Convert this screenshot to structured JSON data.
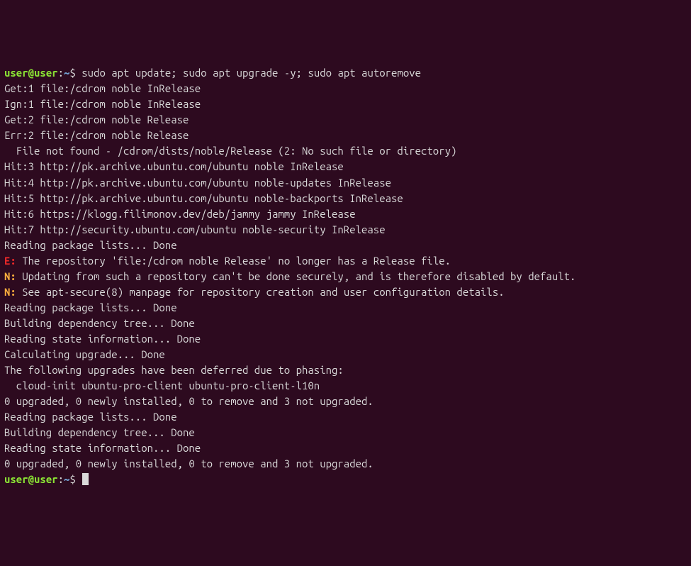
{
  "prompt": {
    "user": "user",
    "at": "@",
    "host": "user",
    "colon": ":",
    "path": "~",
    "dollar": "$"
  },
  "command": "sudo apt update; sudo apt upgrade -y; sudo apt autoremove",
  "lines": [
    "Get:1 file:/cdrom noble InRelease",
    "Ign:1 file:/cdrom noble InRelease",
    "Get:2 file:/cdrom noble Release",
    "Err:2 file:/cdrom noble Release",
    "  File not found - /cdrom/dists/noble/Release (2: No such file or directory)",
    "Hit:3 http://pk.archive.ubuntu.com/ubuntu noble InRelease",
    "Hit:4 http://pk.archive.ubuntu.com/ubuntu noble-updates InRelease",
    "Hit:5 http://pk.archive.ubuntu.com/ubuntu noble-backports InRelease",
    "Hit:6 https://klogg.filimonov.dev/deb/jammy jammy InRelease",
    "Hit:7 http://security.ubuntu.com/ubuntu noble-security InRelease",
    "Reading package lists... Done"
  ],
  "error_line": {
    "prefix": "E:",
    "text": " The repository 'file:/cdrom noble Release' no longer has a Release file."
  },
  "notice1": {
    "prefix": "N:",
    "text": " Updating from such a repository can't be done securely, and is therefore disabled by default."
  },
  "notice2": {
    "prefix": "N:",
    "text": " See apt-secure(8) manpage for repository creation and user configuration details."
  },
  "lines2": [
    "Reading package lists... Done",
    "Building dependency tree... Done",
    "Reading state information... Done",
    "Calculating upgrade... Done",
    "The following upgrades have been deferred due to phasing:",
    "  cloud-init ubuntu-pro-client ubuntu-pro-client-l10n",
    "0 upgraded, 0 newly installed, 0 to remove and 3 not upgraded.",
    "Reading package lists... Done",
    "Building dependency tree... Done",
    "Reading state information... Done",
    "0 upgraded, 0 newly installed, 0 to remove and 3 not upgraded."
  ]
}
